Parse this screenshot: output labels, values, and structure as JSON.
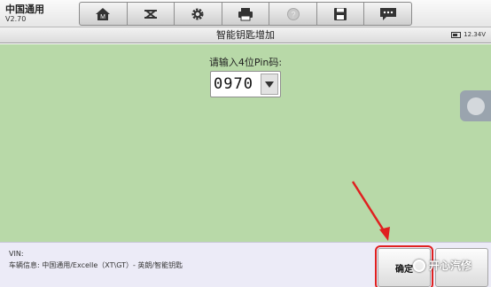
{
  "app": {
    "name": "中国通用",
    "version": "V2.70"
  },
  "toolbar": {
    "icons": [
      "home-icon",
      "vehicle-lift-icon",
      "gear-icon",
      "printer-icon",
      "help-icon",
      "save-icon",
      "message-icon"
    ]
  },
  "title": "智能钥匙增加",
  "battery": {
    "voltage": "12.34V"
  },
  "main": {
    "prompt": "请输入4位Pin码:",
    "pin_value": "0970"
  },
  "status": {
    "vin_label": "VIN:",
    "vehicle_info": "车辆信息: 中国通用/Excelle（XT\\GT）- 英朗/智能钥匙"
  },
  "buttons": {
    "confirm": "确定"
  },
  "watermark": {
    "text": "开心汽修"
  },
  "colors": {
    "main_bg": "#b8d9a8",
    "highlight": "#e02020",
    "bottom_bg": "#ecebf7"
  }
}
